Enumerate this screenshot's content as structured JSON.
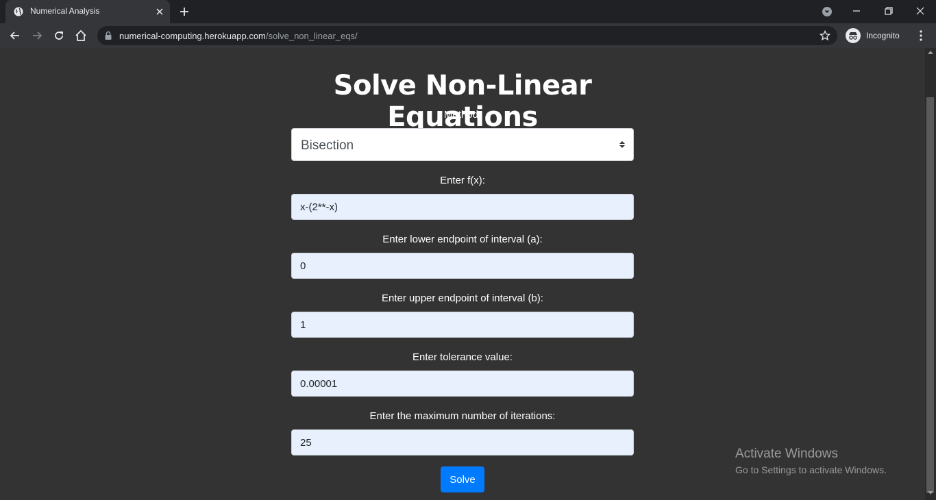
{
  "browser": {
    "tab_title": "Numerical Analysis",
    "url_host": "numerical-computing.herokuapp.com",
    "url_path": "/solve_non_linear_eqs/",
    "incognito_label": "Incognito"
  },
  "page": {
    "title": "Solve Non-Linear Equations",
    "method_label": "Method:",
    "method_value": "Bisection",
    "fx_label": "Enter f(x):",
    "fx_value": "x-(2**-x)",
    "a_label": "Enter lower endpoint of interval (a):",
    "a_value": "0",
    "b_label": "Enter upper endpoint of interval (b):",
    "b_value": "1",
    "tol_label": "Enter tolerance value:",
    "tol_value": "0.00001",
    "iter_label": "Enter the maximum number of iterations:",
    "iter_value": "25",
    "solve_label": "Solve"
  },
  "watermark": {
    "line1": "Activate Windows",
    "line2": "Go to Settings to activate Windows."
  },
  "colors": {
    "page_bg": "#333333",
    "button": "#007bff",
    "input_bg": "#e8f0fe"
  }
}
